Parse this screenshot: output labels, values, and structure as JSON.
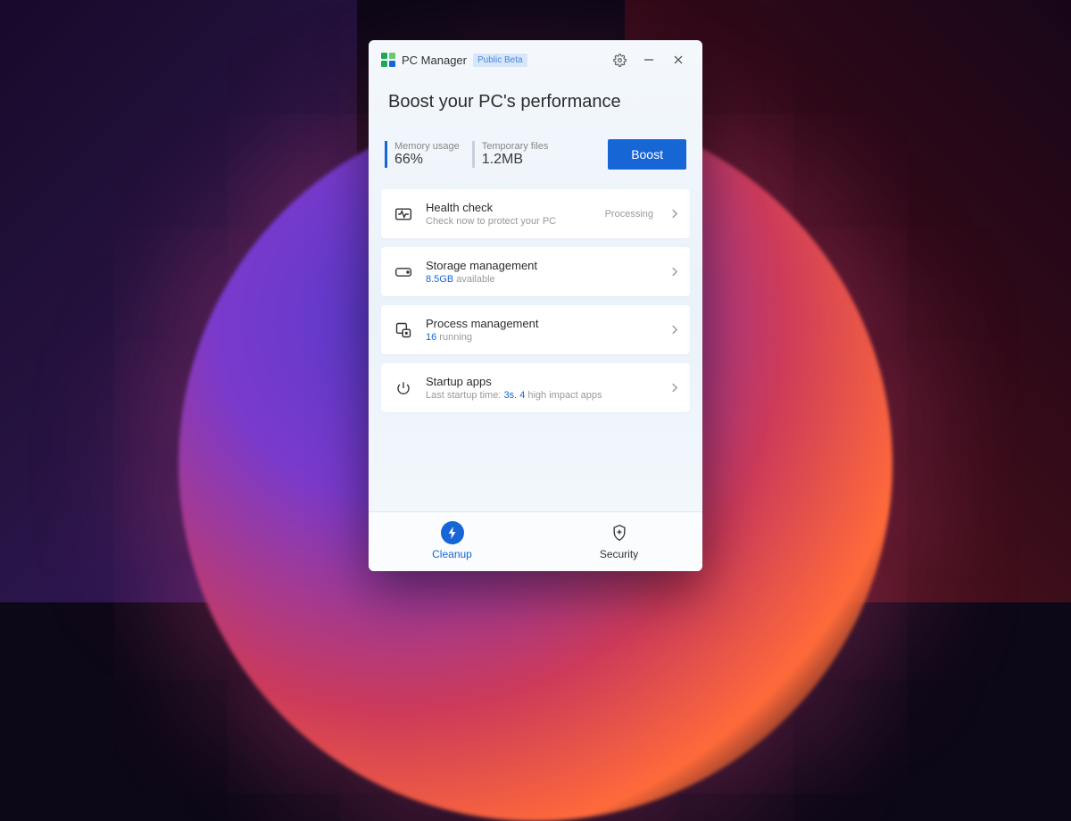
{
  "app": {
    "title": "PC Manager",
    "beta": "Public Beta"
  },
  "headline": "Boost your PC's performance",
  "stats": {
    "memory": {
      "label": "Memory usage",
      "value": "66%"
    },
    "temp": {
      "label": "Temporary files",
      "value": "1.2MB"
    }
  },
  "boost": "Boost",
  "cards": {
    "health": {
      "title": "Health check",
      "sub": "Check now to protect your PC",
      "status": "Processing"
    },
    "storage": {
      "title": "Storage management",
      "value": "8.5GB",
      "suffix": " available"
    },
    "process": {
      "title": "Process management",
      "value": "16",
      "suffix": " running"
    },
    "startup": {
      "title": "Startup apps",
      "prefix": "Last startup time: ",
      "time": "3s.",
      "mid": " ",
      "count": "4",
      "suffix": " high impact apps"
    }
  },
  "tabs": {
    "cleanup": "Cleanup",
    "security": "Security"
  }
}
